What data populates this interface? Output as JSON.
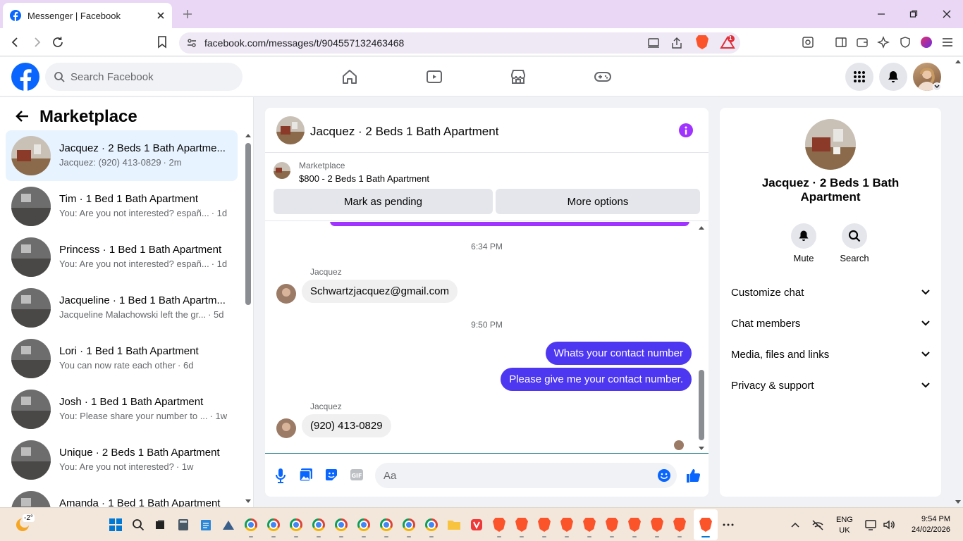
{
  "browser": {
    "tab_title": "Messenger | Facebook",
    "url": "facebook.com/messages/t/904557132463468",
    "brave_badge": "1"
  },
  "fb": {
    "search_placeholder": "Search Facebook"
  },
  "left_panel": {
    "title": "Marketplace",
    "conversations": [
      {
        "name": "Jacquez · 2 Beds 1 Bath Apartme...",
        "preview": "Jacquez: (920) 413-0829",
        "time": "· 2m"
      },
      {
        "name": "Tim · 1 Bed 1 Bath Apartment",
        "preview": "You: Are you not interested? españ...",
        "time": "· 1d"
      },
      {
        "name": "Princess · 1 Bed 1 Bath Apartment",
        "preview": "You: Are you not interested? españ...",
        "time": "· 1d"
      },
      {
        "name": "Jacqueline · 1 Bed 1 Bath Apartm...",
        "preview": "Jacqueline Malachowski left the gr...",
        "time": "· 5d"
      },
      {
        "name": "Lori · 1 Bed 1 Bath Apartment",
        "preview": "You can now rate each other",
        "time": "· 6d"
      },
      {
        "name": "Josh · 1 Bed 1 Bath Apartment",
        "preview": "You: Please share your number to ...",
        "time": "· 1w"
      },
      {
        "name": "Unique · 2 Beds 1 Bath Apartment",
        "preview": "You: Are you not interested?",
        "time": "· 1w"
      },
      {
        "name": "Amanda · 1 Bed 1 Bath Apartment",
        "preview": "",
        "time": ""
      }
    ]
  },
  "chat": {
    "title": "Jacquez · 2 Beds 1 Bath Apartment",
    "marketplace_label": "Marketplace",
    "listing": "$800 - 2 Beds 1 Bath Apartment",
    "mark_pending": "Mark as pending",
    "more_options": "More options",
    "timestamp_1": "6:34 PM",
    "sender_1": "Jacquez",
    "msg_in_1": "Schwartzjacquez@gmail.com",
    "timestamp_2": "9:50 PM",
    "msg_out_1": "Whats your contact number",
    "msg_out_2": "Please give me your contact number.",
    "sender_2": "Jacquez",
    "msg_in_2": "(920) 413-0829",
    "input_placeholder": "Aa"
  },
  "right_panel": {
    "name": "Jacquez · 2 Beds 1 Bath Apartment",
    "mute": "Mute",
    "search": "Search",
    "rows": [
      "Customize chat",
      "Chat members",
      "Media, files and links",
      "Privacy & support"
    ]
  },
  "taskbar": {
    "weather": "-2°",
    "lang_top": "ENG",
    "lang_bottom": "UK",
    "time": "9:54 PM",
    "date": "24/02/2026"
  },
  "colors": {
    "fb_blue": "#0866ff",
    "message_purple": "#4e37f0",
    "info_purple": "#a033ff",
    "active_conv": "#e7f3ff"
  }
}
